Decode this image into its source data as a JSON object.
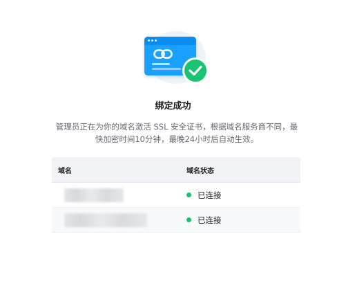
{
  "accent_color": "#1aa0ff",
  "success_color": "#18c471",
  "illustration": {
    "icon": "browser-link-check-icon"
  },
  "dialog": {
    "title": "绑定成功",
    "description": "管理员正在为你的域名激活 SSL 安全证书，根据域名服务商不同，最快加密时间10分钟，最晚24小时后自动生效。"
  },
  "table": {
    "headers": {
      "domain": "域名",
      "status": "域名状态"
    },
    "rows": [
      {
        "domain_redacted": true,
        "status": "已连接",
        "status_color": "#18c471"
      },
      {
        "domain_redacted": true,
        "status": "已连接",
        "status_color": "#18c471"
      }
    ]
  }
}
